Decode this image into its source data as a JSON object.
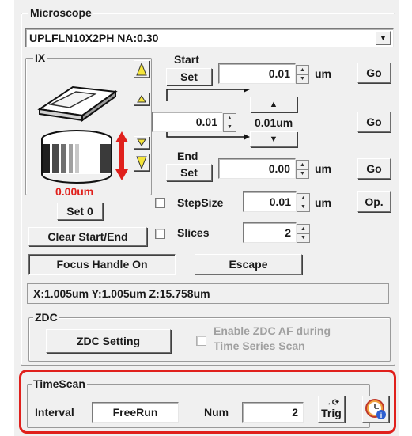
{
  "microscope": {
    "group_label": "Microscope",
    "objective_value": "UPLFLN10X2PH  NA:0.30"
  },
  "ix": {
    "group_label": "IX",
    "position_readout": "0.00um",
    "set0_label": "Set 0",
    "clear_label": "Clear Start/End"
  },
  "start": {
    "label": "Start",
    "set_label": "Set",
    "value": "0.01",
    "unit": "um",
    "go_label": "Go"
  },
  "step": {
    "value": "0.01",
    "display": "0.01um",
    "go_label": "Go"
  },
  "end": {
    "label": "End",
    "set_label": "Set",
    "value": "0.00",
    "unit": "um",
    "go_label": "Go"
  },
  "stepsize": {
    "label": "StepSize",
    "value": "0.01",
    "unit": "um",
    "op_label": "Op."
  },
  "slices": {
    "label": "Slices",
    "value": "2"
  },
  "focus": {
    "handle_label": "Focus Handle On",
    "escape_label": "Escape"
  },
  "coordinates": "X:1.005um Y:1.005um Z:15.758um",
  "zdc": {
    "group_label": "ZDC",
    "setting_label": "ZDC Setting",
    "af_label_line1": "Enable ZDC AF during",
    "af_label_line2": "Time Series Scan"
  },
  "timescan": {
    "group_label": "TimeScan",
    "interval_label": "Interval",
    "interval_value": "FreeRun",
    "num_label": "Num",
    "num_value": "2",
    "trig_label": "Trig",
    "highlight_color": "#e0201c"
  },
  "colors": {
    "readout_red": "#e0201c",
    "arrow_red": "#e0201c",
    "triangle_yellow": "#f4e43a"
  }
}
